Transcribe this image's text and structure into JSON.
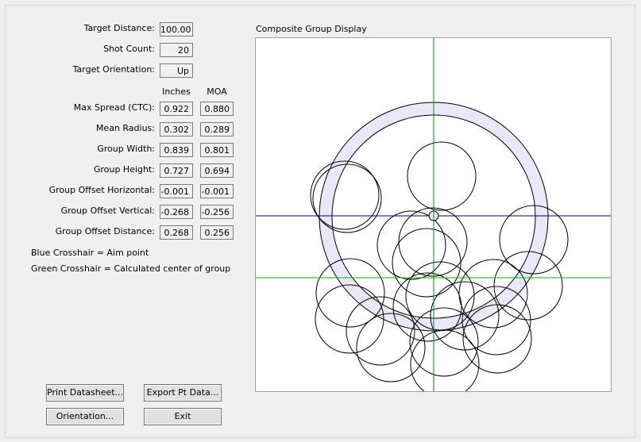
{
  "fields": [
    {
      "name": "target-distance-field",
      "label": "Target Distance:",
      "value": "100.00"
    },
    {
      "name": "shot-count-field",
      "label": "Shot Count:",
      "value": "20"
    },
    {
      "name": "target-orientation-field",
      "label": "Target Orientation:",
      "value": "Up"
    }
  ],
  "columns": {
    "inches": "Inches",
    "moa": "MOA"
  },
  "metrics": [
    {
      "name": "max-spread",
      "label": "Max Spread (CTC):",
      "inches": "0.922",
      "moa": "0.880"
    },
    {
      "name": "mean-radius",
      "label": "Mean Radius:",
      "inches": "0.302",
      "moa": "0.289"
    },
    {
      "name": "group-width",
      "label": "Group Width:",
      "inches": "0.839",
      "moa": "0.801"
    },
    {
      "name": "group-height",
      "label": "Group Height:",
      "inches": "0.727",
      "moa": "0.694"
    },
    {
      "name": "group-offset-horizontal",
      "label": "Group Offset Horizontal:",
      "inches": "-0.001",
      "moa": "-0.001"
    },
    {
      "name": "group-offset-vertical",
      "label": "Group Offset Vertical:",
      "inches": "-0.268",
      "moa": "-0.256"
    },
    {
      "name": "group-offset-distance",
      "label": "Group Offset Distance:",
      "inches": "0.268",
      "moa": "0.256"
    }
  ],
  "legend": {
    "blue": "Blue Crosshair = Aim point",
    "green": "Green Crosshair = Calculated center of group"
  },
  "buttons": {
    "print": "Print Datasheet...",
    "export": "Export Pt Data...",
    "orientation": "Orientation...",
    "exit": "Exit"
  },
  "display": {
    "title": "Composite Group Display",
    "colors": {
      "aim": "#000080",
      "center": "#00c000",
      "ring_fill": "#e8e8f8",
      "shot": "#000000",
      "border": "#a0a0a0"
    }
  }
}
